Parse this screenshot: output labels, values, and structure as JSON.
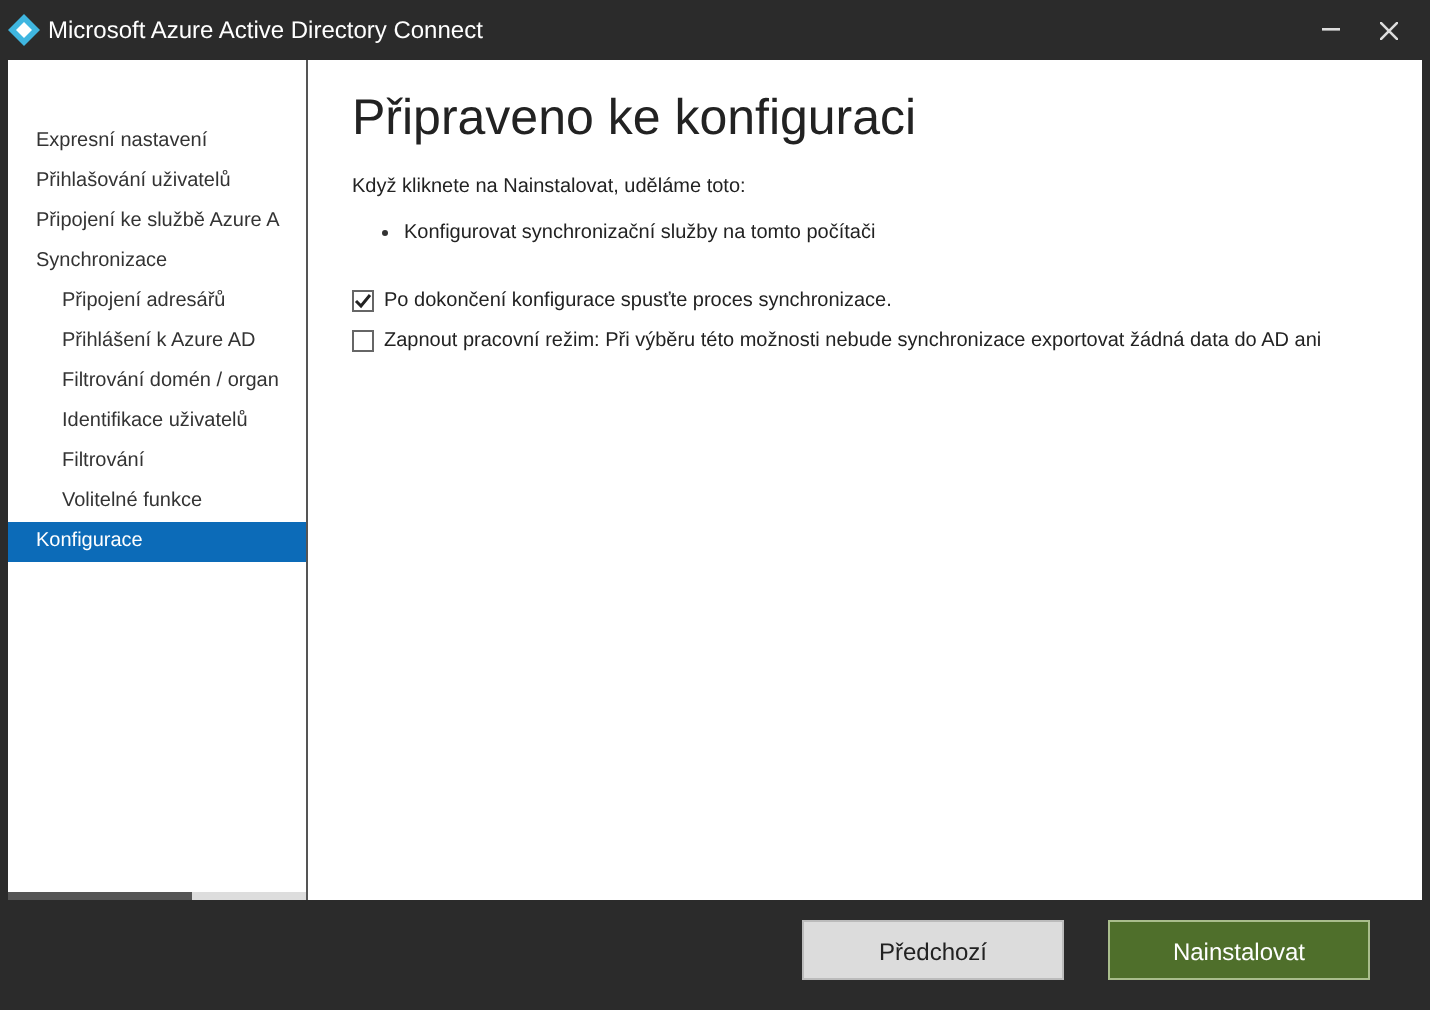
{
  "window": {
    "title": "Microsoft Azure Active Directory Connect"
  },
  "sidebar": {
    "items": [
      {
        "label": "Expresní nastavení",
        "selected": false
      },
      {
        "label": "Přihlašování uživatelů",
        "selected": false
      },
      {
        "label": "Připojení ke službě Azure A",
        "selected": false
      },
      {
        "label": "Synchronizace",
        "selected": false,
        "children": [
          {
            "label": "Připojení adresářů",
            "selected": false
          },
          {
            "label": "Přihlášení k Azure AD",
            "selected": false
          },
          {
            "label": "Filtrování domén / organ",
            "selected": false
          },
          {
            "label": "Identifikace uživatelů",
            "selected": false
          },
          {
            "label": "Filtrování",
            "selected": false
          },
          {
            "label": "Volitelné funkce",
            "selected": false
          }
        ]
      },
      {
        "label": "Konfigurace",
        "selected": true
      }
    ]
  },
  "page": {
    "heading": "Připraveno ke konfiguraci",
    "intro": "Když kliknete na Nainstalovat, uděláme toto:",
    "bullets": [
      "Konfigurovat synchronizační služby na tomto počítači"
    ],
    "options": [
      {
        "label": "Po dokončení konfigurace spusťte proces synchronizace.",
        "checked": true
      },
      {
        "label": "Zapnout pracovní režim: Při výběru této možnosti nebude synchronizace exportovat žádná data do AD ani",
        "checked": false
      }
    ]
  },
  "buttons": [
    {
      "label": "Předchozí",
      "kind": "secondary"
    },
    {
      "label": "Nainstalovat",
      "kind": "primary"
    }
  ]
}
